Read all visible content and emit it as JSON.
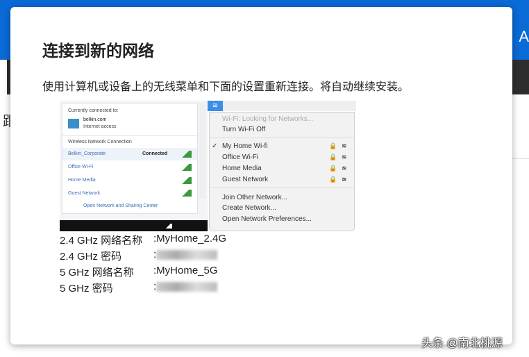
{
  "background": {
    "header_letter": "A",
    "side_char": "跟"
  },
  "dialog": {
    "title": "连接到新的网络",
    "description": "使用计算机或设备上的无线菜单和下面的设置重新连接。将自动继续安装。",
    "windows_panel": {
      "connected_to": "Currently connected to:",
      "network": "belkin.com",
      "access": "Internet access",
      "section": "Wireless Network Connection",
      "networks": [
        {
          "name": "Belkin_Corporate",
          "status": "Connected"
        },
        {
          "name": "Office Wi-Fi",
          "status": ""
        },
        {
          "name": "Home Media",
          "status": ""
        },
        {
          "name": "Guest Network",
          "status": ""
        }
      ],
      "footer": "Open Network and Sharing Center"
    },
    "mac_menu": {
      "status": "Wi-Fi: Looking for Networks...",
      "turn_off": "Turn Wi-Fi Off",
      "networks": [
        {
          "name": "My Home Wi-fi",
          "checked": "✓"
        },
        {
          "name": "Office Wi-Fi",
          "checked": ""
        },
        {
          "name": "Home Media",
          "checked": ""
        },
        {
          "name": "Guest Network",
          "checked": ""
        }
      ],
      "actions": [
        "Join Other Network...",
        "Create Network...",
        "Open Network Preferences..."
      ]
    },
    "settings": [
      {
        "label": "2.4 GHz 网络名称",
        "value": ":MyHome_2.4G"
      },
      {
        "label": "2.4 GHz 密码",
        "value": ":"
      },
      {
        "label": "5 GHz 网络名称",
        "value": ":MyHome_5G"
      },
      {
        "label": "5 GHz 密码",
        "value": ":"
      }
    ]
  },
  "watermark": "头条 @南北桃源"
}
